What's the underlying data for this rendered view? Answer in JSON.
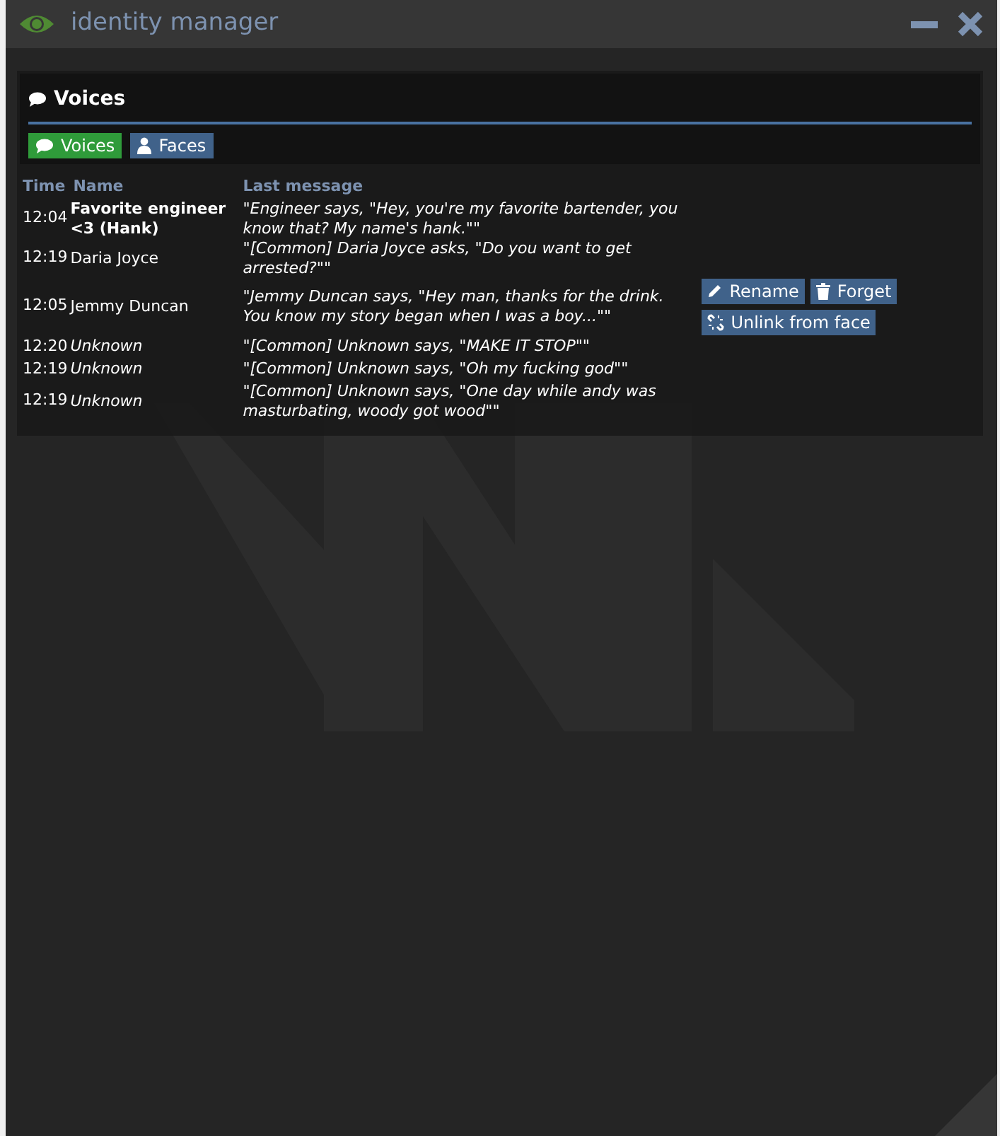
{
  "window": {
    "title": "identity manager"
  },
  "section": {
    "title": "Voices"
  },
  "tabs": [
    {
      "label": "Voices",
      "selected": true,
      "kind": "comment"
    },
    {
      "label": "Faces",
      "selected": false,
      "kind": "user"
    }
  ],
  "table": {
    "columns": [
      "Time",
      "Name",
      "Last message"
    ],
    "rows": [
      {
        "time": "12:04",
        "name": "Favorite engineer <3 (Hank)",
        "kind": "named",
        "message": "\"Engineer says, \"Hey, you're my favorite bartender, you know that? My name's hank.\"\""
      },
      {
        "time": "12:19",
        "name": "Daria Joyce",
        "kind": "known",
        "message": "\"[Common] Daria Joyce asks, \"Do you want to get arrested?\"\""
      },
      {
        "time": "12:05",
        "name": "Jemmy Duncan",
        "kind": "known",
        "message": "\"Jemmy Duncan says, \"Hey man, thanks for the drink. You know my story began when I was a boy...\"\"",
        "actions": [
          {
            "label": "Rename",
            "kind": "pencil"
          },
          {
            "label": "Forget",
            "kind": "trash"
          },
          {
            "label": "Unlink from face",
            "kind": "unlink"
          }
        ]
      },
      {
        "time": "12:20",
        "name": "Unknown",
        "kind": "unknown",
        "message": "\"[Common] Unknown says, \"MAKE IT STOP\"\""
      },
      {
        "time": "12:19",
        "name": "Unknown",
        "kind": "unknown",
        "message": "\"[Common] Unknown says, \"Oh my fucking god\"\""
      },
      {
        "time": "12:19",
        "name": "Unknown",
        "kind": "unknown",
        "message": "\"[Common] Unknown says, \"One day while andy was masturbating, woody got wood\"\""
      }
    ]
  }
}
